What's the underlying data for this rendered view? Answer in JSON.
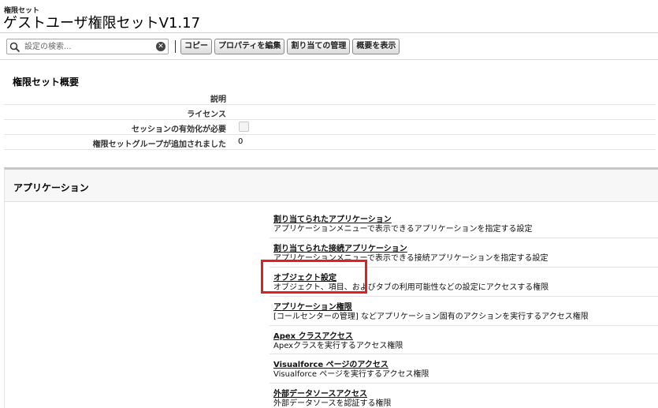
{
  "header": {
    "breadcrumb": "権限セット",
    "title": "ゲストユーザ権限セットV1.17"
  },
  "toolbar": {
    "search_placeholder": "設定の検索...",
    "buttons": [
      "コピー",
      "プロパティを編集",
      "割り当ての管理",
      "概要を表示"
    ]
  },
  "summary": {
    "title": "権限セット概要",
    "rows": [
      {
        "label": "説明",
        "value": ""
      },
      {
        "label": "ライセンス",
        "value": ""
      },
      {
        "label": "セッションの有効化が必要",
        "value": "",
        "checked": false
      },
      {
        "label": "権限セットグループが追加されました",
        "value": "0"
      }
    ]
  },
  "apps": {
    "title": "アプリケーション",
    "items": [
      {
        "link": "割り当てられたアプリケーション",
        "desc": "アプリケーションメニューで表示できるアプリケーションを指定する設定"
      },
      {
        "link": "割り当てられた接続アプリケーション",
        "desc": "アプリケーションメニューで表示できる接続アプリケーションを指定する設定"
      },
      {
        "link": "オブジェクト設定",
        "desc": "オブジェクト、項目、およびタブの利用可能性などの設定にアクセスする権限"
      },
      {
        "link": "アプリケーション権限",
        "desc": "[コールセンターの管理] などアプリケーション固有のアクションを実行するアクセス権限"
      },
      {
        "link": "Apex クラスアクセス",
        "desc": "Apexクラスを実行するアクセス権限"
      },
      {
        "link": "Visualforce ページのアクセス",
        "desc": "Visualforce ページを実行するアクセス権限"
      },
      {
        "link": "外部データソースアクセス",
        "desc": "外部データソースを認証する権限"
      }
    ]
  },
  "colors": {
    "highlight": "#e02020"
  }
}
